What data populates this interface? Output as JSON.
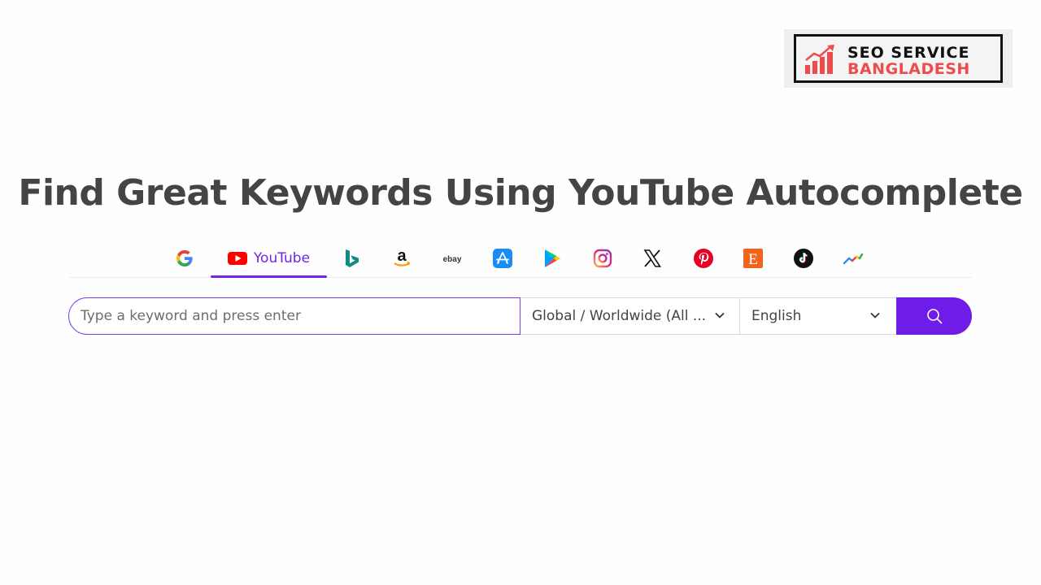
{
  "brand": {
    "line1": "SEO SERVICE",
    "line2": "BANGLADESH",
    "accent_color": "#ef4b4b"
  },
  "page": {
    "title": "Find Great Keywords Using YouTube Autocomplete"
  },
  "tabs": {
    "active": "youtube",
    "items": [
      {
        "id": "google",
        "icon": "google-icon"
      },
      {
        "id": "youtube",
        "icon": "youtube-icon",
        "label": "YouTube"
      },
      {
        "id": "bing",
        "icon": "bing-icon"
      },
      {
        "id": "amazon",
        "icon": "amazon-icon"
      },
      {
        "id": "ebay",
        "icon": "ebay-icon"
      },
      {
        "id": "app-store",
        "icon": "app-store-icon"
      },
      {
        "id": "play-store",
        "icon": "play-store-icon"
      },
      {
        "id": "instagram",
        "icon": "instagram-icon"
      },
      {
        "id": "x",
        "icon": "x-icon"
      },
      {
        "id": "pinterest",
        "icon": "pinterest-icon"
      },
      {
        "id": "etsy",
        "icon": "etsy-icon"
      },
      {
        "id": "tiktok",
        "icon": "tiktok-icon"
      },
      {
        "id": "trends",
        "icon": "trends-icon"
      }
    ],
    "accent_color": "#7323e6"
  },
  "search": {
    "placeholder": "Type a keyword and press enter",
    "value": "",
    "country_selected": "Global / Worldwide (All ...",
    "language_selected": "English",
    "button_icon": "search-icon",
    "button_color": "#6f1ce8"
  },
  "icon_text": {
    "ebay": "ebay",
    "amazon": "a",
    "etsy": "E"
  }
}
